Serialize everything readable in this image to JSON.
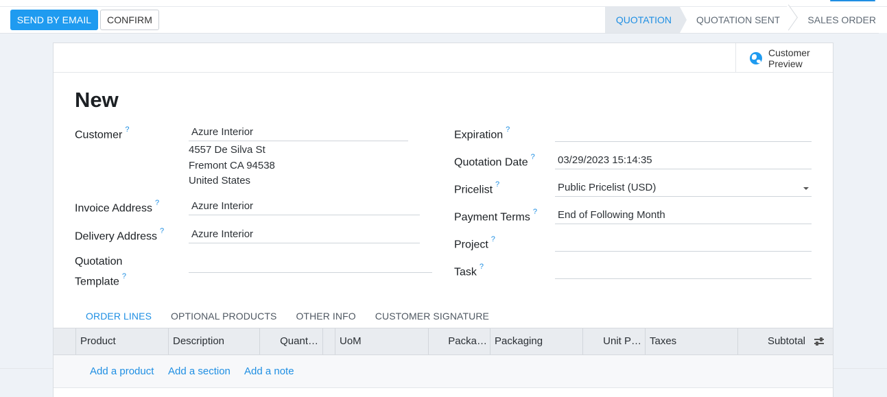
{
  "toolbar": {
    "send_email_label": "SEND BY EMAIL",
    "confirm_label": "CONFIRM"
  },
  "stages": [
    {
      "label": "QUOTATION",
      "active": true
    },
    {
      "label": "QUOTATION SENT",
      "active": false
    },
    {
      "label": "SALES ORDER",
      "active": false
    }
  ],
  "colors": {
    "accent": "#1f9bf0",
    "link": "#1f8fe3",
    "background": "#eef2f7"
  },
  "sheet": {
    "customer_preview_label": "Customer Preview",
    "customer_preview_icon": "globe-icon",
    "title": "New"
  },
  "form_left": {
    "customer": {
      "label": "Customer",
      "help": "?",
      "value": "Azure Interior",
      "address": [
        "4557 De Silva St",
        "Fremont CA 94538",
        "United States"
      ]
    },
    "invoice_address": {
      "label": "Invoice Address",
      "help": "?",
      "value": "Azure Interior"
    },
    "delivery_address": {
      "label": "Delivery Address",
      "help": "?",
      "value": "Azure Interior"
    },
    "quotation_template": {
      "label_line1": "Quotation",
      "label_line2": "Template",
      "help": "?",
      "value": ""
    }
  },
  "form_right": {
    "expiration": {
      "label": "Expiration",
      "help": "?",
      "value": ""
    },
    "quotation_date": {
      "label": "Quotation Date",
      "help": "?",
      "value": "03/29/2023 15:14:35"
    },
    "pricelist": {
      "label": "Pricelist",
      "help": "?",
      "value": "Public Pricelist (USD)"
    },
    "payment_terms": {
      "label": "Payment Terms",
      "help": "?",
      "value": "End of Following Month"
    },
    "project": {
      "label": "Project",
      "help": "?",
      "value": ""
    },
    "task": {
      "label": "Task",
      "help": "?",
      "value": ""
    }
  },
  "tabs": [
    {
      "label": "ORDER LINES",
      "active": true
    },
    {
      "label": "OPTIONAL PRODUCTS",
      "active": false
    },
    {
      "label": "OTHER INFO",
      "active": false
    },
    {
      "label": "CUSTOMER SIGNATURE",
      "active": false
    }
  ],
  "table": {
    "columns": [
      "Product",
      "Description",
      "Quant…",
      "UoM",
      "Packa…",
      "Packaging",
      "Unit P…",
      "Taxes",
      "Subtotal"
    ],
    "add_links": [
      "Add a product",
      "Add a section",
      "Add a note"
    ]
  }
}
